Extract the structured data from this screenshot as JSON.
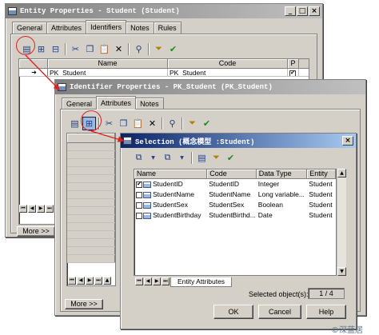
{
  "win1": {
    "title": "Entity Properties - Student (Student)",
    "tabs": [
      "General",
      "Attributes",
      "Identifiers",
      "Notes",
      "Rules"
    ],
    "columns": {
      "name": "Name",
      "code": "Code",
      "p": "P"
    },
    "row1": {
      "name": "PK_Student",
      "code": "PK_Student"
    },
    "more_label": "More >>"
  },
  "win2": {
    "title": "Identifier Properties - PK_Student (PK_Student)",
    "tabs": [
      "General",
      "Attributes",
      "Notes"
    ],
    "more_label": "More >>"
  },
  "win3": {
    "title": "Selection (概念模型 :Student)",
    "columns": {
      "name": "Name",
      "code": "Code",
      "type": "Data Type",
      "entity": "Entity"
    },
    "rows": [
      {
        "name": "StudentID",
        "code": "StudentID",
        "type": "Integer",
        "entity": "Student",
        "checked": true
      },
      {
        "name": "StudentName",
        "code": "StudentName",
        "type": "Long variable...",
        "entity": "Student",
        "checked": false
      },
      {
        "name": "StudentSex",
        "code": "StudentSex",
        "type": "Boolean",
        "entity": "Student",
        "checked": false
      },
      {
        "name": "StudentBirthday",
        "code": "StudentBirthd...",
        "type": "Date",
        "entity": "Student",
        "checked": false
      }
    ],
    "tab_label": "Entity Attributes",
    "selected_label": "Selected object(s):",
    "selected_count": "1 / 4",
    "ok_label": "OK",
    "cancel_label": "Cancel",
    "help_label": "Help"
  },
  "watermark": "©深蓝居",
  "colors": {
    "active_title": "#0a246a",
    "arrow": "#e02020"
  }
}
